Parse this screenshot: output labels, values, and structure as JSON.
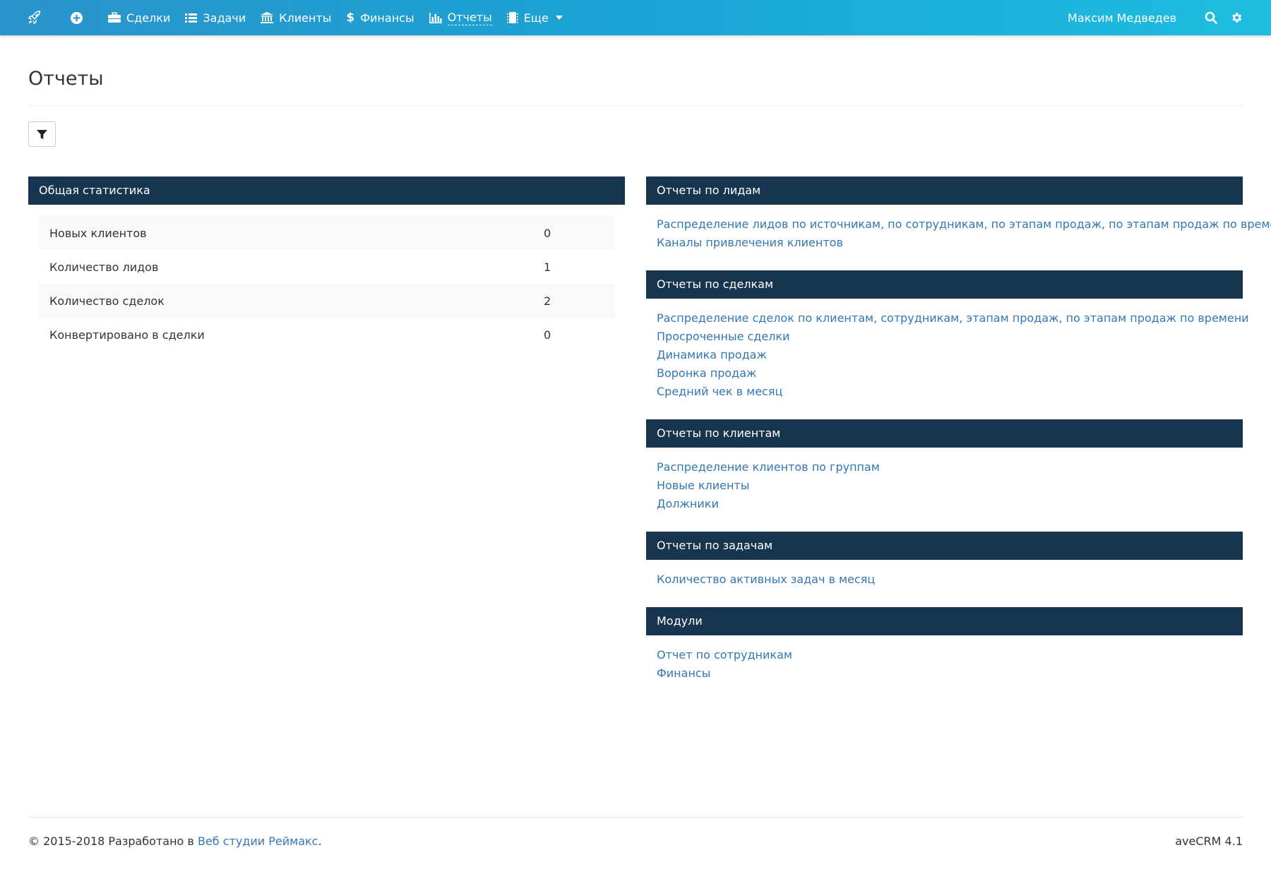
{
  "nav": {
    "items": [
      {
        "label": "Сделки",
        "icon": "briefcase-icon"
      },
      {
        "label": "Задачи",
        "icon": "list-icon"
      },
      {
        "label": "Клиенты",
        "icon": "bank-icon"
      },
      {
        "label": "Финансы",
        "icon": "dollar-icon"
      },
      {
        "label": "Отчеты",
        "icon": "bar-chart-icon",
        "active": true
      },
      {
        "label": "Еще",
        "icon": "chip-icon",
        "dropdown": true
      }
    ],
    "user_name": "Максим Медведев"
  },
  "page": {
    "title": "Отчеты"
  },
  "general_stats": {
    "title": "Общая статистика",
    "rows": [
      {
        "label": "Новых клиентов",
        "value": "0"
      },
      {
        "label": "Количество лидов",
        "value": "1"
      },
      {
        "label": "Количество сделок",
        "value": "2"
      },
      {
        "label": "Конвертировано в сделки",
        "value": "0"
      }
    ]
  },
  "sections": [
    {
      "title": "Отчеты по лидам",
      "links": [
        "Распределение лидов по источникам, по сотрудникам, по этапам продаж, по этапам продаж по времени",
        "Каналы привлечения клиентов"
      ]
    },
    {
      "title": "Отчеты по сделкам",
      "links": [
        "Распределение сделок по клиентам, сотрудникам, этапам продаж, по этапам продаж по времени",
        "Просроченные сделки",
        "Динамика продаж",
        "Воронка продаж",
        "Средний чек в месяц"
      ]
    },
    {
      "title": "Отчеты по клиентам",
      "links": [
        "Распределение клиентов по группам",
        "Новые клиенты",
        "Должники"
      ]
    },
    {
      "title": "Отчеты по задачам",
      "links": [
        "Количество активных задач в месяц"
      ]
    },
    {
      "title": "Модули",
      "links": [
        "Отчет по сотрудникам",
        "Финансы"
      ]
    }
  ],
  "footer": {
    "prefix": "© 2015-2018 Разработано в ",
    "link": "Веб студии Реймакс",
    "suffix": ".",
    "version": "aveCRM 4.1"
  },
  "colors": {
    "header_gradient_start": "#2a94cc",
    "header_gradient_end": "#1fbde0",
    "panel_header": "#17354f",
    "link": "#3377b6"
  }
}
